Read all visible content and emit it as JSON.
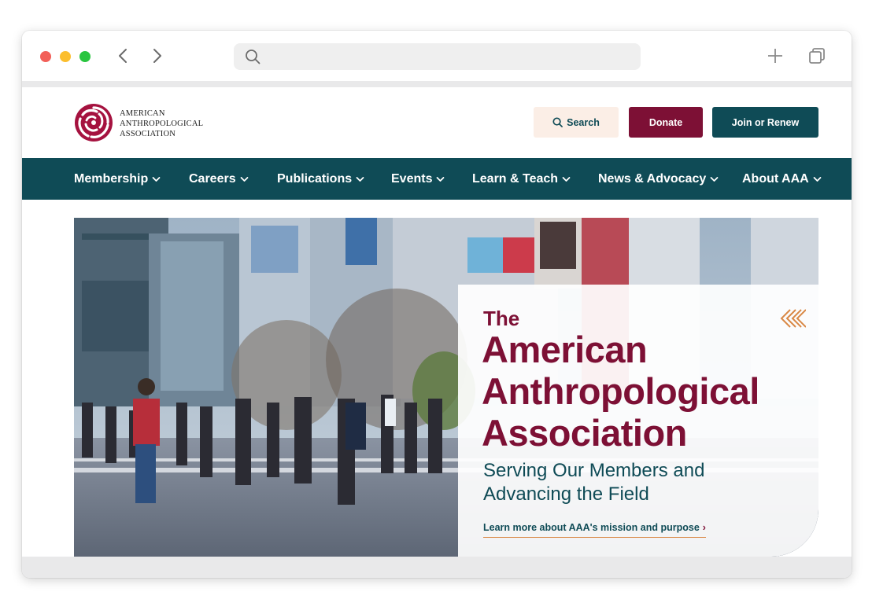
{
  "browser": {
    "url": "",
    "icons": [
      "back-arrow-icon",
      "forward-arrow-icon",
      "search-icon",
      "new-tab-plus-icon",
      "tabs-overview-icon"
    ]
  },
  "header": {
    "logo_lines": [
      "AMERICAN",
      "ANTHROPOLOGICAL",
      "ASSOCIATION"
    ],
    "search_label": "Search",
    "donate_label": "Donate",
    "join_label": "Join or Renew"
  },
  "nav": {
    "items": [
      {
        "label": "Membership"
      },
      {
        "label": "Careers"
      },
      {
        "label": "Publications"
      },
      {
        "label": "Events"
      },
      {
        "label": "Learn & Teach"
      },
      {
        "label": "News & Advocacy"
      },
      {
        "label": "About AAA"
      }
    ]
  },
  "hero": {
    "the": "The",
    "title_lines": [
      "American",
      "Anthropological",
      "Association"
    ],
    "subtitle_lines": [
      "Serving Our Members and",
      "Advancing the Field"
    ],
    "link_label": "Learn more about AAA's mission and purpose",
    "link_arrow": "›"
  },
  "colors": {
    "maroon": "#7d1035",
    "teal": "#0f4b56",
    "search_bg": "#fbeee6",
    "accent_orange": "#d98845"
  }
}
